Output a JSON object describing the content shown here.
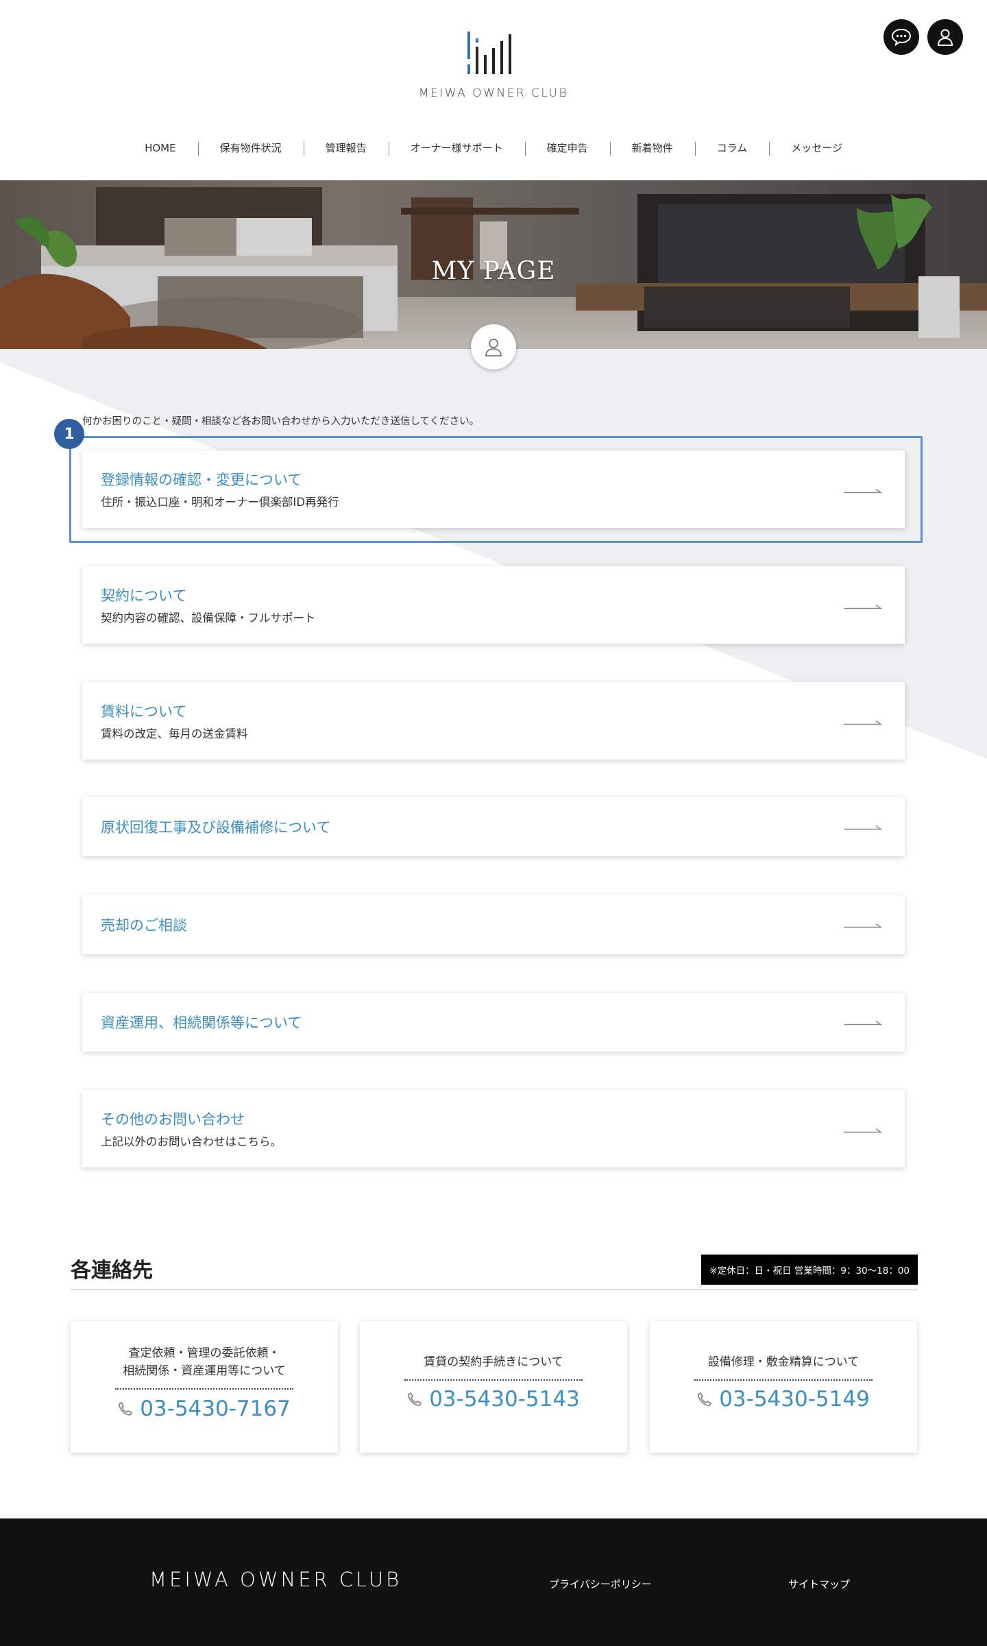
{
  "header": {
    "logo_text": "MEIWA OWNER CLUB",
    "icons": [
      "chat-icon",
      "user-icon"
    ]
  },
  "nav": {
    "items": [
      {
        "label": "HOME"
      },
      {
        "label": "保有物件状況"
      },
      {
        "label": "管理報告"
      },
      {
        "label": "オーナー様サポート"
      },
      {
        "label": "確定申告"
      },
      {
        "label": "新着物件"
      },
      {
        "label": "コラム"
      },
      {
        "label": "メッセージ"
      }
    ]
  },
  "hero": {
    "title": "MY PAGE"
  },
  "intro_text": "何かお困りのこと・疑問・相談など各お問い合わせから入力いただき送信してください。",
  "step_badge": "1",
  "menu": [
    {
      "title": "登録情報の確認・変更について",
      "sub": "住所・振込口座・明和オーナー倶楽部ID再発行"
    },
    {
      "title": "契約について",
      "sub": "契約内容の確認、設備保障・フルサポート"
    },
    {
      "title": "賃料について",
      "sub": "賃料の改定、毎月の送金賃料"
    },
    {
      "title": "原状回復工事及び設備補修について",
      "sub": ""
    },
    {
      "title": "売却のご相談",
      "sub": ""
    },
    {
      "title": "資産運用、相続関係等について",
      "sub": ""
    },
    {
      "title": "その他のお問い合わせ",
      "sub": "上記以外のお問い合わせはこちら。"
    }
  ],
  "contacts": {
    "title": "各連絡先",
    "hours": "※定休日：日・祝日 営業時間：9：30〜18：00",
    "cards": [
      {
        "label": "査定依頼・管理の委託依頼・\n相続関係・資産運用等について",
        "phone": "03-5430-7167"
      },
      {
        "label": "賃貸の契約手続きについて",
        "phone": "03-5430-5143"
      },
      {
        "label": "設備修理・敷金精算について",
        "phone": "03-5430-5149"
      }
    ]
  },
  "footer": {
    "logo_text": "MEIWA OWNER CLUB",
    "links": [
      {
        "label": "プライバシーポリシー"
      },
      {
        "label": "サイトマップ"
      }
    ]
  },
  "colors": {
    "accent": "#3a8fc0",
    "highlight": "#5b8fd6",
    "badge": "#2f5f9f",
    "footer_bg": "#111111"
  }
}
